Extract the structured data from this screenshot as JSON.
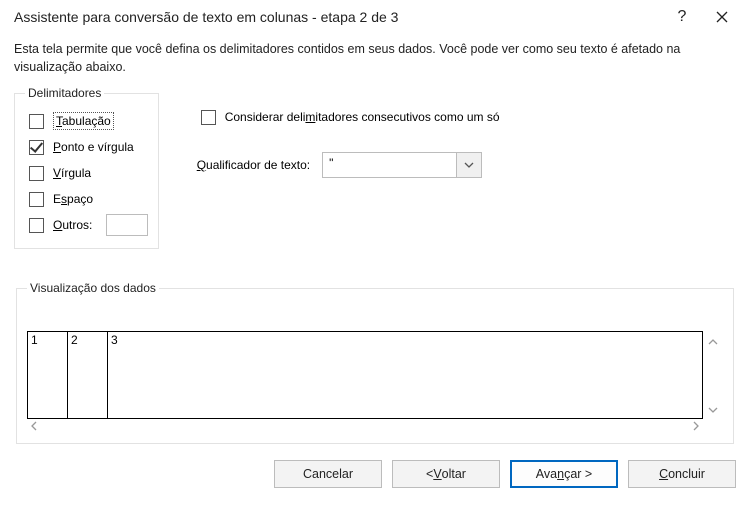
{
  "title": "Assistente para conversão de texto em colunas - etapa 2 de 3",
  "intro": "Esta tela permite que você defina os delimitadores contidos em seus dados. Você pode ver como seu texto é afetado na visualização abaixo.",
  "delimiters": {
    "legend": "Delimitadores",
    "tab": {
      "label": "Tabulação",
      "checked": false
    },
    "semicolon": {
      "label": "Ponto e vírgula",
      "checked": true
    },
    "comma": {
      "label": "Vírgula",
      "checked": false
    },
    "space": {
      "label": "Espaço",
      "checked": false
    },
    "other": {
      "label": "Outros:",
      "checked": false,
      "value": ""
    }
  },
  "consecutive": {
    "label": "Considerar delimitadores consecutivos como um só",
    "checked": false
  },
  "qualifier": {
    "label": "Qualificador de texto:",
    "value": "\""
  },
  "preview": {
    "legend": "Visualização dos dados",
    "columns": [
      "1",
      "2",
      "3"
    ]
  },
  "buttons": {
    "cancel": "Cancelar",
    "back": "< Voltar",
    "next": "Avançar >",
    "finish": "Concluir"
  }
}
